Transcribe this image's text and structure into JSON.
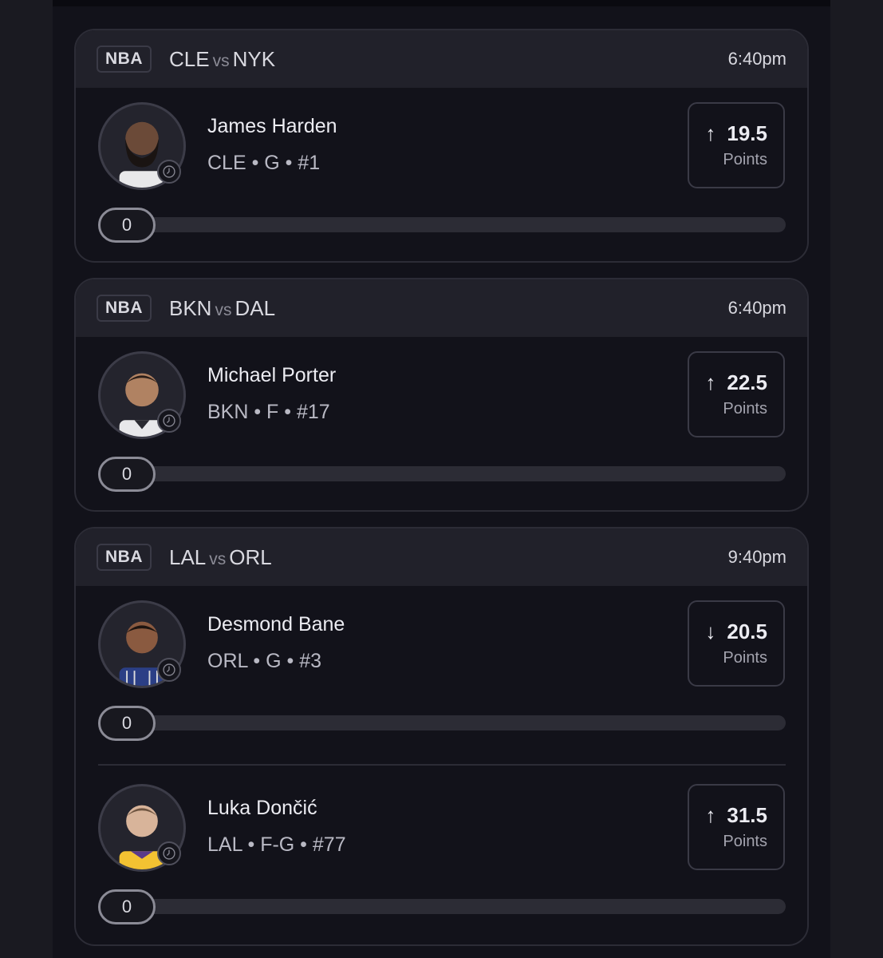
{
  "cards": [
    {
      "league": "NBA",
      "team1": "CLE",
      "vs": "vs",
      "team2": "NYK",
      "time": "6:40pm",
      "picks": [
        {
          "name": "James Harden",
          "info": "CLE • G • #1",
          "direction": "up",
          "arrow": "↑",
          "line": "19.5",
          "stat": "Points",
          "progress": "0"
        }
      ]
    },
    {
      "league": "NBA",
      "team1": "BKN",
      "vs": "vs",
      "team2": "DAL",
      "time": "6:40pm",
      "picks": [
        {
          "name": "Michael Porter",
          "info": "BKN • F • #17",
          "direction": "up",
          "arrow": "↑",
          "line": "22.5",
          "stat": "Points",
          "progress": "0"
        }
      ]
    },
    {
      "league": "NBA",
      "team1": "LAL",
      "vs": "vs",
      "team2": "ORL",
      "time": "9:40pm",
      "picks": [
        {
          "name": "Desmond Bane",
          "info": "ORL • G • #3",
          "direction": "down",
          "arrow": "↓",
          "line": "20.5",
          "stat": "Points",
          "progress": "0"
        },
        {
          "name": "Luka Dončić",
          "info": "LAL • F-G • #77",
          "direction": "up",
          "arrow": "↑",
          "line": "31.5",
          "stat": "Points",
          "progress": "0"
        }
      ]
    }
  ],
  "icons": {
    "avatar": "player-headshot-icon",
    "clock": "clock-icon"
  },
  "colors": {
    "background": "#12121a",
    "header": "#21212a",
    "border": "#2c2c36",
    "text": "#ececf2"
  }
}
